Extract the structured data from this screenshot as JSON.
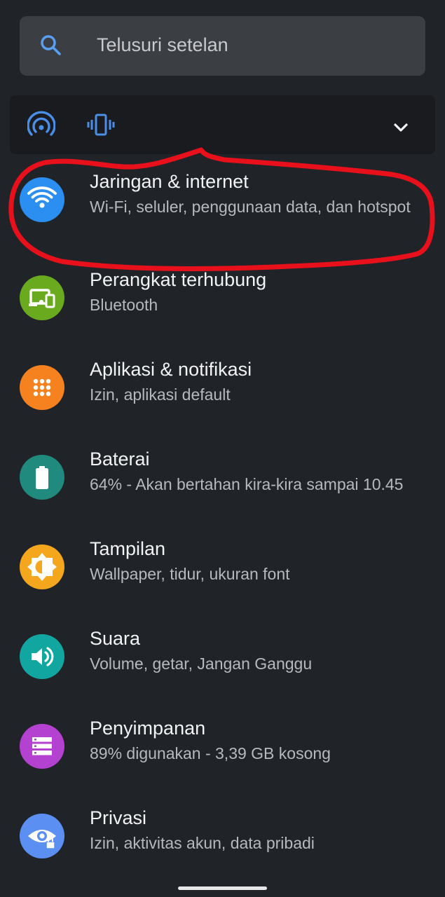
{
  "search": {
    "placeholder": "Telusuri setelan"
  },
  "conditions": {
    "icons": [
      "hotspot-icon",
      "vibrate-icon"
    ],
    "expand_icon": "chevron-down-icon"
  },
  "settings": [
    {
      "title": "Jaringan & internet",
      "subtitle": "Wi-Fi, seluler, penggunaan data, dan hotspot",
      "icon": "wifi-icon",
      "color": "#2a8ff0"
    },
    {
      "title": "Perangkat terhubung",
      "subtitle": "Bluetooth",
      "icon": "connected-devices-icon",
      "color": "#6aaa1e"
    },
    {
      "title": "Aplikasi & notifikasi",
      "subtitle": "Izin, aplikasi default",
      "icon": "apps-icon",
      "color": "#f5821f"
    },
    {
      "title": "Baterai",
      "subtitle": "64% - Akan bertahan kira-kira sampai 10.45",
      "icon": "battery-icon",
      "color": "#1f8a7d"
    },
    {
      "title": "Tampilan",
      "subtitle": "Wallpaper, tidur, ukuran font",
      "icon": "brightness-icon",
      "color": "#f4a61c"
    },
    {
      "title": "Suara",
      "subtitle": "Volume, getar, Jangan Ganggu",
      "icon": "volume-icon",
      "color": "#11a7a0"
    },
    {
      "title": "Penyimpanan",
      "subtitle": "89% digunakan - 3,39 GB kosong",
      "icon": "storage-icon",
      "color": "#b441cf"
    },
    {
      "title": "Privasi",
      "subtitle": "Izin, aktivitas akun, data pribadi",
      "icon": "privacy-icon",
      "color": "#5b8ff2"
    }
  ],
  "colors": {
    "background": "#202328",
    "annotation": "#e8101b",
    "accent": "#4a8ee8"
  }
}
